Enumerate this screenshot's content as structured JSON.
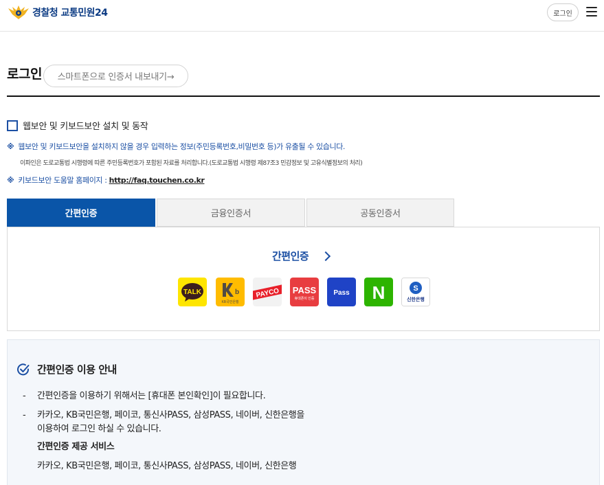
{
  "header": {
    "site_name": "경찰청 교통민원24",
    "login_label": "로그인",
    "menu_icon": "hamburger-icon"
  },
  "title_section": {
    "title": "로그인",
    "export_label": "스마트폰으로 인증서 내보내기→"
  },
  "security": {
    "checkbox_label": "웹보안 및 키보드보안 설치 및 동작",
    "note_mark": "※",
    "note_1": "웹보안 및 키보드보안을 설치하지 않을 경우 입력하는 정보(주민등록번호,비밀번호 등)가 유출될 수 있습니다.",
    "note_2": "이파인은 도로교통법 시행령에 따른 주민등록번호가 포함된 자료를 처리합니다.(도로교통법 시행령 제87조3 민감정보 및 고유식별정보의 처리)",
    "help_label": "키보드보안 도움말 홈페이지 : ",
    "help_link": "http://faq.touchen.co.kr"
  },
  "tabs": [
    {
      "label": "간편인증",
      "active": true
    },
    {
      "label": "금융인증서",
      "active": false
    },
    {
      "label": "공동인증서",
      "active": false
    }
  ],
  "simple_auth": {
    "title": "간편인증",
    "providers": [
      {
        "name": "kakao",
        "text": "TALK",
        "color": "#fee500"
      },
      {
        "name": "kb",
        "text": "KB국민은행",
        "color": "#ffbc00"
      },
      {
        "name": "payco",
        "text": "PAYCO",
        "color": "#f2f2f2"
      },
      {
        "name": "pass",
        "text": "PASS",
        "subtext": "휴대폰이 인증",
        "color": "#e83d40"
      },
      {
        "name": "samsung-pass",
        "text": "Pass",
        "color": "#1f43c6"
      },
      {
        "name": "naver",
        "text": "N",
        "color": "#2db400"
      },
      {
        "name": "shinhan",
        "text": "신한은행",
        "color": "#ffffff"
      }
    ]
  },
  "info": {
    "title": "간편인증 이용 안내",
    "dash": "-",
    "item_1": "간편인증을 이용하기 위해서는 [휴대폰 본인확인]이 필요합니다.",
    "item_2_line_1": "카카오, KB국민은행, 페이코, 통신사PASS, 삼성PASS, 네이버, 신한은행을",
    "item_2_line_2": "이용하여 로그인 하실 수 있습니다.",
    "subheading": "간편인증 제공 서비스",
    "services": "카카오, KB국민은행, 페이코, 통신사PASS, 삼성PASS, 네이버, 신한은행"
  },
  "colors": {
    "primary": "#0a55a8",
    "accent_text": "#1b4fa3",
    "info_bg": "#f4f7fb"
  }
}
